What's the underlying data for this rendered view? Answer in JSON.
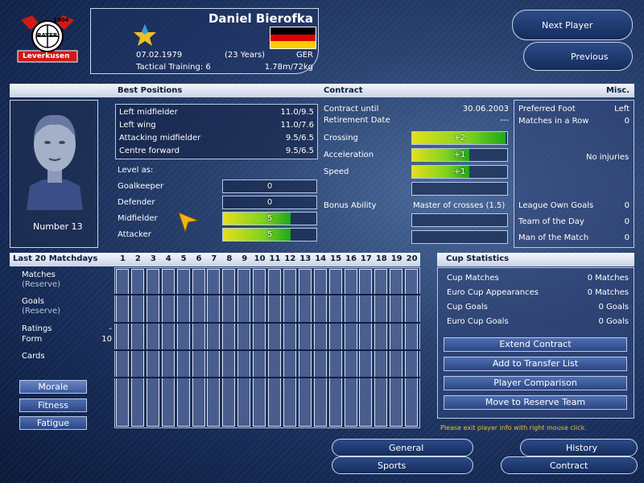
{
  "player": {
    "name": "Daniel Bierofka",
    "dob": "07.02.1979",
    "age": "(23 Years)",
    "nationality": "GER",
    "tactical_training": "Tactical Training: 6",
    "height_weight": "1.78m/72kg",
    "number": "Number 13"
  },
  "nav": {
    "next": "Next Player",
    "previous": "Previous"
  },
  "headers": {
    "best_positions": "Best Positions",
    "contract": "Contract",
    "misc": "Misc."
  },
  "best_positions": [
    {
      "pos": "Left midfielder",
      "val": "11.0/9.5"
    },
    {
      "pos": "Left wing",
      "val": "11.0/7.6"
    },
    {
      "pos": "Attacking midfielder",
      "val": "9.5/6.5"
    },
    {
      "pos": "Centre forward",
      "val": "9.5/6.5"
    }
  ],
  "level_as": {
    "title": "Level as:",
    "rows": [
      {
        "label": "Goalkeeper",
        "value": "0",
        "fill": 0
      },
      {
        "label": "Defender",
        "value": "0",
        "fill": 0
      },
      {
        "label": "Midfielder",
        "value": "5",
        "fill": 0.72
      },
      {
        "label": "Attacker",
        "value": "5",
        "fill": 0.72
      }
    ]
  },
  "contract": {
    "until_label": "Contract until",
    "until": "30.06.2003",
    "retire_label": "Retirement Date",
    "retire": "---",
    "skills": [
      {
        "label": "Crossing",
        "value": "+2",
        "fill": 0.98
      },
      {
        "label": "Acceleration",
        "value": "+1",
        "fill": 0.6
      },
      {
        "label": "Speed",
        "value": "+1",
        "fill": 0.6
      },
      {
        "label": "",
        "value": "",
        "fill": 0
      }
    ],
    "bonus_label": "Bonus Ability",
    "bonus": "Master of crosses (1.5)"
  },
  "misc": {
    "pref_foot_label": "Preferred Foot",
    "pref_foot": "Left",
    "matches_row_label": "Matches in a Row",
    "matches_row": "0",
    "injuries": "No injuries",
    "league_goals_label": "League Own Goals",
    "league_goals": "0",
    "team_day_label": "Team of the Day",
    "team_day": "0",
    "motm_label": "Man of the Match",
    "motm": "0"
  },
  "matchdays": {
    "title": "Last 20 Matchdays",
    "columns": [
      "1",
      "2",
      "3",
      "4",
      "5",
      "6",
      "7",
      "8",
      "9",
      "10",
      "11",
      "12",
      "13",
      "14",
      "15",
      "16",
      "17",
      "18",
      "19",
      "20"
    ],
    "labels": {
      "matches": "Matches",
      "matches_reserve": "(Reserve)",
      "goals": "Goals",
      "goals_reserve": "(Reserve)",
      "ratings": "Ratings",
      "ratings_val": "-",
      "form": "Form",
      "form_val": "10",
      "cards": "Cards"
    },
    "buttons": {
      "morale": "Morale",
      "fitness": "Fitness",
      "fatigue": "Fatigue"
    }
  },
  "cup": {
    "title": "Cup Statistics",
    "rows": [
      {
        "label": "Cup Matches",
        "value": "0 Matches"
      },
      {
        "label": "Euro Cup Appearances",
        "value": "0 Matches"
      },
      {
        "label": "Cup Goals",
        "value": "0 Goals"
      },
      {
        "label": "Euro Cup Goals",
        "value": "0 Goals"
      }
    ],
    "actions": {
      "extend": "Extend Contract",
      "transfer": "Add to Transfer List",
      "compare": "Player Comparison",
      "reserve": "Move to Reserve Team"
    },
    "hint": "Please exit player info with right mouse click."
  },
  "bottom_tabs": {
    "general": "General",
    "sports": "Sports",
    "history": "History",
    "contract": "Contract"
  },
  "club": {
    "logo_top": "1904",
    "logo_mid": "BAYER",
    "logo_bottom": "Leverkusen"
  },
  "colors": {
    "accent": "#e6e01a",
    "good": "#1fa81a",
    "hint": "#f0c020",
    "club_red": "#d01818"
  }
}
